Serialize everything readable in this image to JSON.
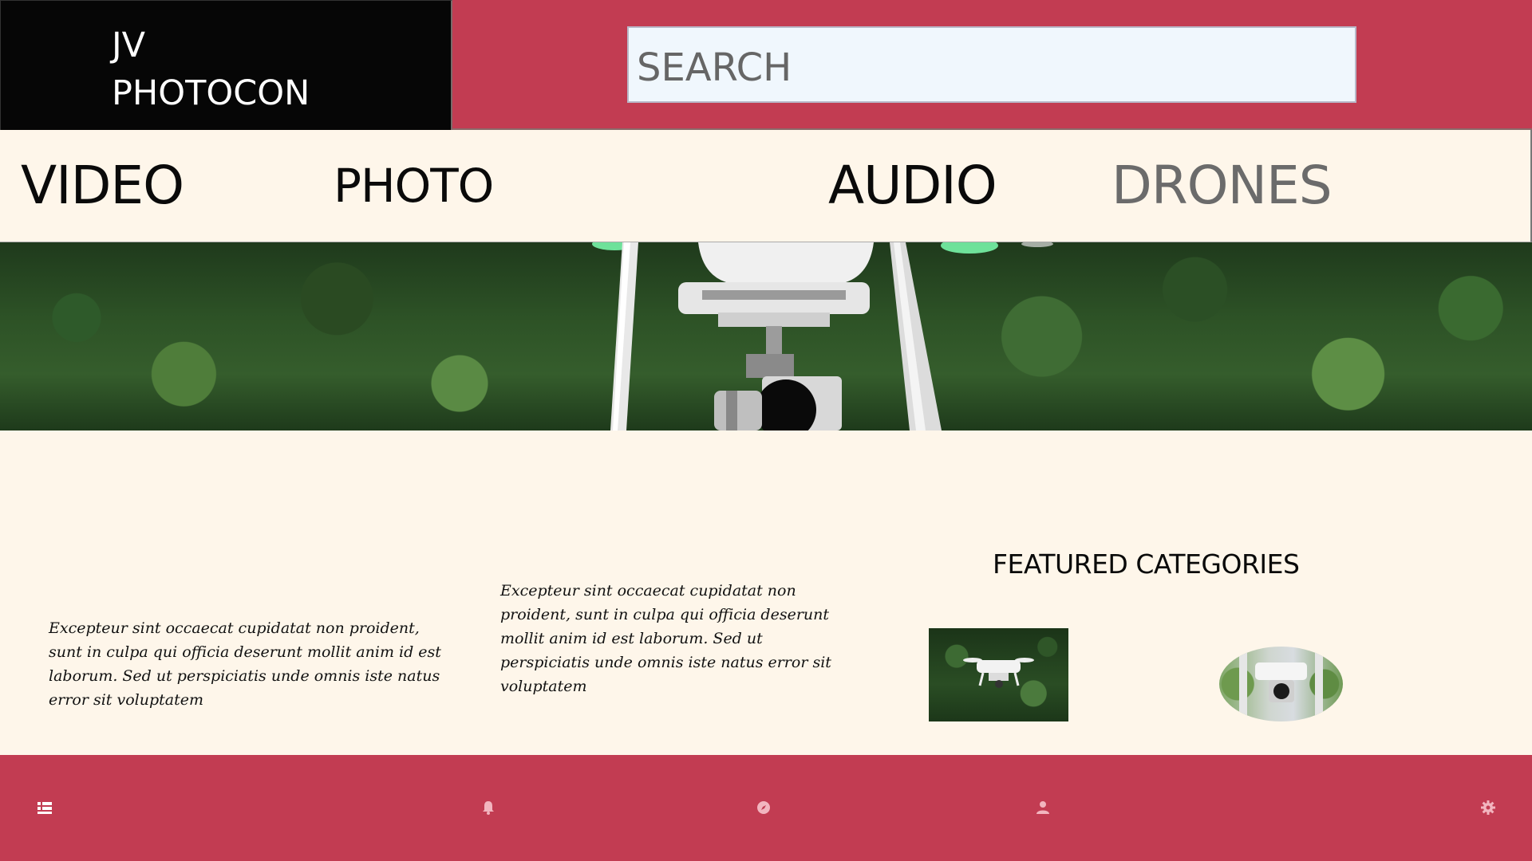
{
  "header": {
    "logo_line1": "JV",
    "logo_line2": "PHOTOCON",
    "search_placeholder": "SEARCH"
  },
  "nav": {
    "items": [
      {
        "label": "VIDEO"
      },
      {
        "label": "PHOTO"
      },
      {
        "label": "AUDIO"
      },
      {
        "label": "DRONES"
      }
    ]
  },
  "content": {
    "paragraph_1": "Excepteur sint occaecat cupidatat non proident, sunt in culpa qui officia deserunt mollit anim id est laborum. Sed ut perspiciatis unde omnis iste natus error sit voluptatem",
    "paragraph_2": "Excepteur sint occaecat cupidatat non proident, sunt in culpa qui officia deserunt mollit anim id est laborum. Sed ut perspiciatis unde omnis iste natus error sit voluptatem",
    "featured_title": "FEATURED CATEGORIES"
  },
  "footer": {
    "icons": [
      "list-icon",
      "bell-icon",
      "compass-icon",
      "user-icon",
      "gear-icon"
    ]
  },
  "colors": {
    "brand": "#c23c52",
    "nav_bg": "#fef6ea",
    "logo_bg": "#060606",
    "search_bg": "#f0f7fd",
    "inactive_nav": "#6b6b6b"
  }
}
